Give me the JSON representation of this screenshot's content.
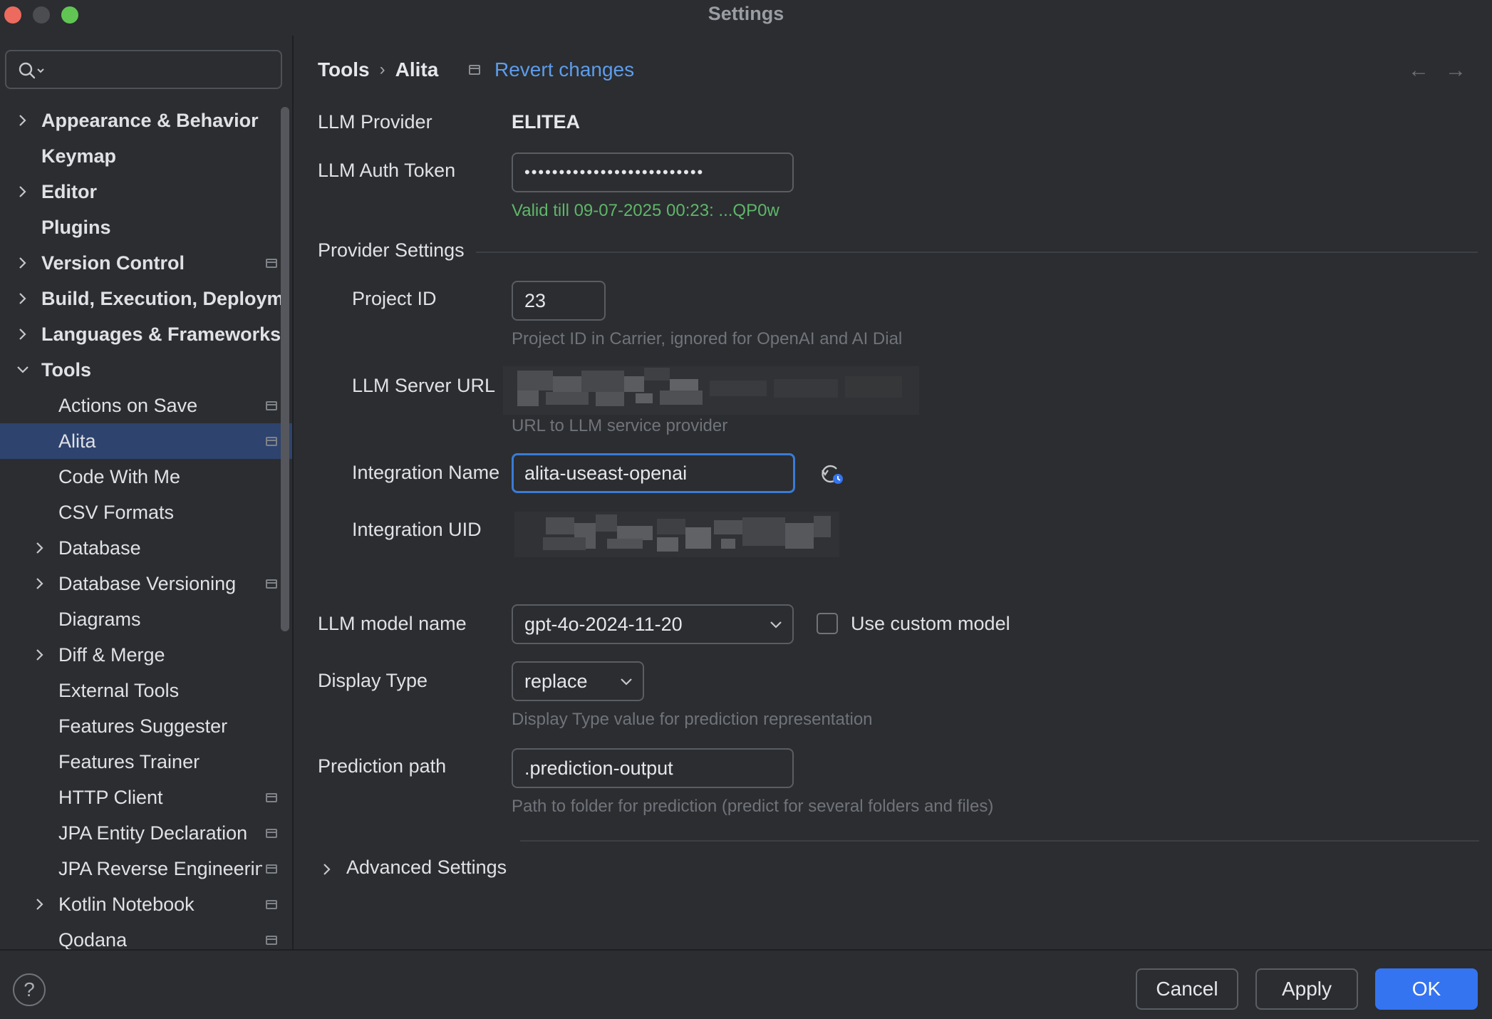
{
  "window": {
    "title": "Settings"
  },
  "sidebar": {
    "search": {
      "placeholder": ""
    },
    "items": [
      {
        "label": "Appearance & Behavior",
        "level": 0,
        "bold": true,
        "expandable": true,
        "expanded": false,
        "pinned": false
      },
      {
        "label": "Keymap",
        "level": 0,
        "bold": true,
        "expandable": false,
        "pinned": false
      },
      {
        "label": "Editor",
        "level": 0,
        "bold": true,
        "expandable": true,
        "expanded": false,
        "pinned": false
      },
      {
        "label": "Plugins",
        "level": 0,
        "bold": true,
        "expandable": false,
        "pinned": false
      },
      {
        "label": "Version Control",
        "level": 0,
        "bold": true,
        "expandable": true,
        "expanded": false,
        "pinned": true
      },
      {
        "label": "Build, Execution, Deployment",
        "level": 0,
        "bold": true,
        "expandable": true,
        "expanded": false,
        "pinned": false
      },
      {
        "label": "Languages & Frameworks",
        "level": 0,
        "bold": true,
        "expandable": true,
        "expanded": false,
        "pinned": false
      },
      {
        "label": "Tools",
        "level": 0,
        "bold": true,
        "expandable": true,
        "expanded": true,
        "pinned": false
      },
      {
        "label": "Actions on Save",
        "level": 1,
        "bold": false,
        "expandable": false,
        "pinned": true
      },
      {
        "label": "Alita",
        "level": 1,
        "bold": false,
        "expandable": false,
        "pinned": true,
        "selected": true
      },
      {
        "label": "Code With Me",
        "level": 1,
        "bold": false,
        "expandable": false,
        "pinned": false
      },
      {
        "label": "CSV Formats",
        "level": 1,
        "bold": false,
        "expandable": false,
        "pinned": false
      },
      {
        "label": "Database",
        "level": 1,
        "bold": false,
        "expandable": true,
        "expanded": false,
        "pinned": false
      },
      {
        "label": "Database Versioning",
        "level": 1,
        "bold": false,
        "expandable": true,
        "expanded": false,
        "pinned": true
      },
      {
        "label": "Diagrams",
        "level": 1,
        "bold": false,
        "expandable": false,
        "pinned": false
      },
      {
        "label": "Diff & Merge",
        "level": 1,
        "bold": false,
        "expandable": true,
        "expanded": false,
        "pinned": false
      },
      {
        "label": "External Tools",
        "level": 1,
        "bold": false,
        "expandable": false,
        "pinned": false
      },
      {
        "label": "Features Suggester",
        "level": 1,
        "bold": false,
        "expandable": false,
        "pinned": false
      },
      {
        "label": "Features Trainer",
        "level": 1,
        "bold": false,
        "expandable": false,
        "pinned": false
      },
      {
        "label": "HTTP Client",
        "level": 1,
        "bold": false,
        "expandable": false,
        "pinned": true
      },
      {
        "label": "JPA Entity Declaration",
        "level": 1,
        "bold": false,
        "expandable": false,
        "pinned": true
      },
      {
        "label": "JPA Reverse Engineering",
        "level": 1,
        "bold": false,
        "expandable": false,
        "pinned": true
      },
      {
        "label": "Kotlin Notebook",
        "level": 1,
        "bold": false,
        "expandable": true,
        "expanded": false,
        "pinned": true
      },
      {
        "label": "Qodana",
        "level": 1,
        "bold": false,
        "expandable": false,
        "pinned": true
      }
    ]
  },
  "header": {
    "breadcrumb": [
      "Tools",
      "Alita"
    ],
    "breadcrumb_separator": "›",
    "revert_label": "Revert changes",
    "nav_back": "←",
    "nav_forward": "→"
  },
  "form": {
    "llm_provider": {
      "label": "LLM Provider",
      "value": "ELITEA"
    },
    "llm_auth_token": {
      "label": "LLM Auth Token",
      "value": "••••••••••••••••••••••••••",
      "status": "Valid till 09-07-2025 00:23: ...QP0w"
    },
    "provider_settings": {
      "title": "Provider Settings",
      "project_id": {
        "label": "Project ID",
        "value": "23",
        "hint": "Project ID in Carrier, ignored for OpenAI and AI Dial"
      },
      "llm_server_url": {
        "label": "LLM Server URL",
        "hint": "URL to LLM service provider"
      },
      "integration_name": {
        "label": "Integration Name",
        "value": "alita-useast-openai"
      },
      "integration_uid": {
        "label": "Integration UID"
      }
    },
    "llm_model_name": {
      "label": "LLM model name",
      "value": "gpt-4o-2024-11-20",
      "custom_model_label": "Use custom model",
      "custom_model_checked": false
    },
    "display_type": {
      "label": "Display Type",
      "value": "replace",
      "hint": "Display Type value for prediction representation"
    },
    "prediction_path": {
      "label": "Prediction path",
      "value": ".prediction-output",
      "hint": "Path to folder for prediction (predict for several folders and files)"
    },
    "advanced_settings": {
      "label": "Advanced Settings",
      "expanded": false
    }
  },
  "footer": {
    "help_label": "?",
    "cancel_label": "Cancel",
    "apply_label": "Apply",
    "ok_label": "OK"
  },
  "colors": {
    "accent": "#3574f0",
    "link": "#5d9cec",
    "valid": "#5fb66a",
    "selection": "#2e436e"
  }
}
